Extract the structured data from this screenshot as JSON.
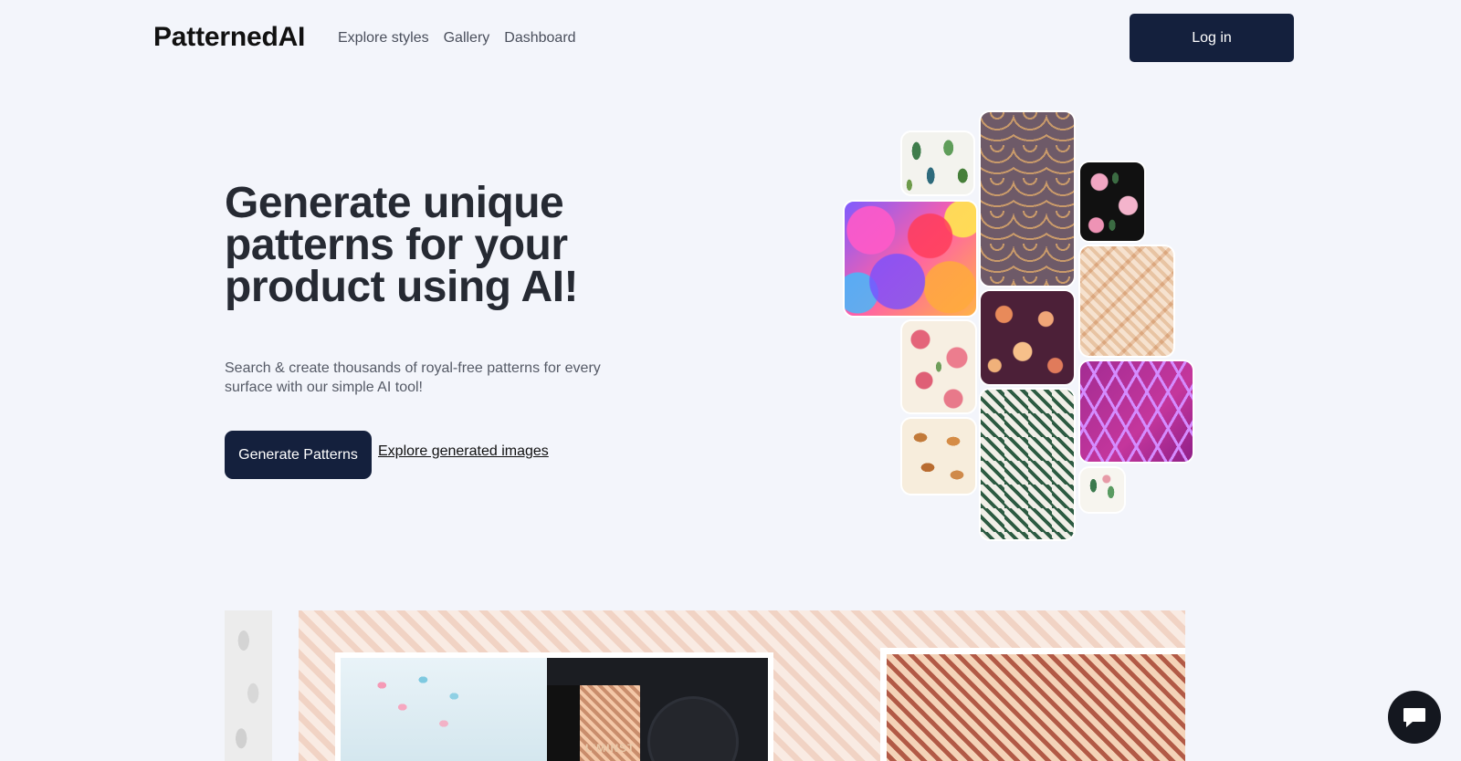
{
  "header": {
    "logo": "PatternedAI",
    "nav": [
      "Explore styles",
      "Gallery",
      "Dashboard"
    ],
    "login_label": "Log in"
  },
  "hero": {
    "title": "Generate unique patterns for your product using AI!",
    "subtitle": "Search & create thousands of royal-free patterns for every surface with our simple AI tool!",
    "primary_cta": "Generate Patterns",
    "secondary_cta": "Explore generated images"
  },
  "showcase": {
    "product_brand": "L'MINST"
  },
  "colors": {
    "background": "#f3f5fb",
    "primary": "#14203d"
  },
  "icons": {
    "chat": "chat-bubble-icon"
  }
}
